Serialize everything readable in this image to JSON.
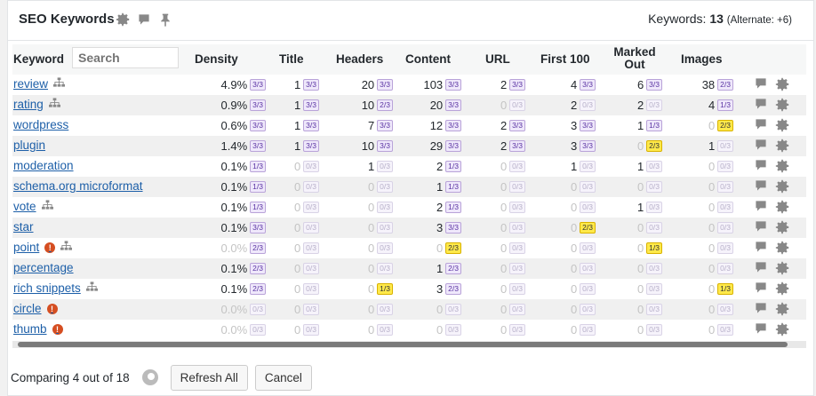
{
  "header": {
    "title": "SEO Keywords",
    "keywords_label": "Keywords:",
    "keywords_count": "13",
    "alternate_text": "(Alternate: +6)"
  },
  "columns": {
    "keyword": "Keyword",
    "density": "Density",
    "title": "Title",
    "headers": "Headers",
    "content": "Content",
    "url": "URL",
    "first100": "First 100",
    "marked_out": "Marked Out",
    "images": "Images"
  },
  "search": {
    "placeholder": "Search"
  },
  "rows": [
    {
      "kw": "review",
      "sitemap": true,
      "alert": false,
      "faded_density": false,
      "density": "4.9%",
      "density_b": "3/3",
      "title": [
        "1",
        "3/3"
      ],
      "headers": [
        "20",
        "3/3"
      ],
      "content": [
        "103",
        "3/3"
      ],
      "url": [
        "2",
        "3/3"
      ],
      "first100": [
        "4",
        "3/3"
      ],
      "marked": [
        "6",
        "3/3"
      ],
      "images": [
        "38",
        "2/3"
      ]
    },
    {
      "kw": "rating",
      "sitemap": true,
      "alert": false,
      "faded_density": false,
      "density": "0.9%",
      "density_b": "3/3",
      "title": [
        "1",
        "3/3"
      ],
      "headers": [
        "10",
        "2/3"
      ],
      "content": [
        "20",
        "3/3"
      ],
      "url": [
        "0",
        "0/3"
      ],
      "first100": [
        "2",
        "0/3"
      ],
      "marked": [
        "2",
        "0/3"
      ],
      "images": [
        "4",
        "1/3"
      ]
    },
    {
      "kw": "wordpress",
      "sitemap": false,
      "alert": false,
      "faded_density": false,
      "density": "0.6%",
      "density_b": "3/3",
      "title": [
        "1",
        "3/3"
      ],
      "headers": [
        "7",
        "3/3"
      ],
      "content": [
        "12",
        "3/3"
      ],
      "url": [
        "2",
        "3/3"
      ],
      "first100": [
        "3",
        "3/3"
      ],
      "marked": [
        "1",
        "1/3"
      ],
      "images": [
        "0",
        "2/3"
      ]
    },
    {
      "kw": "plugin",
      "sitemap": false,
      "alert": false,
      "faded_density": false,
      "density": "1.4%",
      "density_b": "3/3",
      "title": [
        "1",
        "3/3"
      ],
      "headers": [
        "10",
        "3/3"
      ],
      "content": [
        "29",
        "3/3"
      ],
      "url": [
        "2",
        "3/3"
      ],
      "first100": [
        "3",
        "3/3"
      ],
      "marked": [
        "0",
        "2/3"
      ],
      "images": [
        "1",
        "0/3"
      ]
    },
    {
      "kw": "moderation",
      "sitemap": false,
      "alert": false,
      "faded_density": false,
      "density": "0.1%",
      "density_b": "1/3",
      "title": [
        "0",
        "0/3"
      ],
      "headers": [
        "1",
        "0/3"
      ],
      "content": [
        "2",
        "1/3"
      ],
      "url": [
        "0",
        "0/3"
      ],
      "first100": [
        "1",
        "0/3"
      ],
      "marked": [
        "1",
        "0/3"
      ],
      "images": [
        "0",
        "0/3"
      ]
    },
    {
      "kw": "schema.org microformat",
      "sitemap": false,
      "alert": false,
      "faded_density": false,
      "density": "0.1%",
      "density_b": "1/3",
      "title": [
        "0",
        "0/3"
      ],
      "headers": [
        "0",
        "0/3"
      ],
      "content": [
        "1",
        "1/3"
      ],
      "url": [
        "0",
        "0/3"
      ],
      "first100": [
        "0",
        "0/3"
      ],
      "marked": [
        "0",
        "0/3"
      ],
      "images": [
        "0",
        "0/3"
      ]
    },
    {
      "kw": "vote",
      "sitemap": true,
      "alert": false,
      "faded_density": false,
      "density": "0.1%",
      "density_b": "1/3",
      "title": [
        "0",
        "0/3"
      ],
      "headers": [
        "0",
        "0/3"
      ],
      "content": [
        "2",
        "1/3"
      ],
      "url": [
        "0",
        "0/3"
      ],
      "first100": [
        "0",
        "0/3"
      ],
      "marked": [
        "1",
        "0/3"
      ],
      "images": [
        "0",
        "0/3"
      ]
    },
    {
      "kw": "star",
      "sitemap": false,
      "alert": false,
      "faded_density": false,
      "density": "0.1%",
      "density_b": "3/3",
      "title": [
        "0",
        "0/3"
      ],
      "headers": [
        "0",
        "0/3"
      ],
      "content": [
        "3",
        "3/3"
      ],
      "url": [
        "0",
        "0/3"
      ],
      "first100": [
        "0",
        "2/3"
      ],
      "marked": [
        "0",
        "0/3"
      ],
      "images": [
        "0",
        "0/3"
      ]
    },
    {
      "kw": "point",
      "sitemap": true,
      "alert": true,
      "faded_density": true,
      "density": "0.0%",
      "density_b": "2/3",
      "title": [
        "0",
        "0/3"
      ],
      "headers": [
        "0",
        "0/3"
      ],
      "content": [
        "0",
        "2/3"
      ],
      "url": [
        "0",
        "0/3"
      ],
      "first100": [
        "0",
        "0/3"
      ],
      "marked": [
        "0",
        "1/3"
      ],
      "images": [
        "0",
        "0/3"
      ]
    },
    {
      "kw": "percentage",
      "sitemap": false,
      "alert": false,
      "faded_density": false,
      "density": "0.1%",
      "density_b": "2/3",
      "title": [
        "0",
        "0/3"
      ],
      "headers": [
        "0",
        "0/3"
      ],
      "content": [
        "1",
        "2/3"
      ],
      "url": [
        "0",
        "0/3"
      ],
      "first100": [
        "0",
        "0/3"
      ],
      "marked": [
        "0",
        "0/3"
      ],
      "images": [
        "0",
        "0/3"
      ]
    },
    {
      "kw": "rich snippets",
      "sitemap": true,
      "alert": false,
      "faded_density": false,
      "density": "0.1%",
      "density_b": "2/3",
      "title": [
        "0",
        "0/3"
      ],
      "headers": [
        "0",
        "1/3"
      ],
      "content": [
        "3",
        "2/3"
      ],
      "url": [
        "0",
        "0/3"
      ],
      "first100": [
        "0",
        "0/3"
      ],
      "marked": [
        "0",
        "0/3"
      ],
      "images": [
        "0",
        "1/3"
      ]
    },
    {
      "kw": "circle",
      "sitemap": false,
      "alert": true,
      "faded_density": true,
      "density": "0.0%",
      "density_b": "0/3",
      "title": [
        "0",
        "0/3"
      ],
      "headers": [
        "0",
        "0/3"
      ],
      "content": [
        "0",
        "0/3"
      ],
      "url": [
        "0",
        "0/3"
      ],
      "first100": [
        "0",
        "0/3"
      ],
      "marked": [
        "0",
        "0/3"
      ],
      "images": [
        "0",
        "0/3"
      ]
    },
    {
      "kw": "thumb",
      "sitemap": false,
      "alert": true,
      "faded_density": true,
      "density": "0.0%",
      "density_b": "0/3",
      "title": [
        "0",
        "0/3"
      ],
      "headers": [
        "0",
        "0/3"
      ],
      "content": [
        "0",
        "0/3"
      ],
      "url": [
        "0",
        "0/3"
      ],
      "first100": [
        "0",
        "0/3"
      ],
      "marked": [
        "0",
        "0/3"
      ],
      "images": [
        "0",
        "0/3"
      ]
    }
  ],
  "footer": {
    "comparing_text": "Comparing 4 out of 18",
    "refresh_label": "Refresh All",
    "cancel_label": "Cancel"
  },
  "colors": {
    "link": "#1d5fa8",
    "badge_purple": "#5b35a3",
    "badge_yellow": "#ffe94a",
    "alert": "#d54e21"
  }
}
